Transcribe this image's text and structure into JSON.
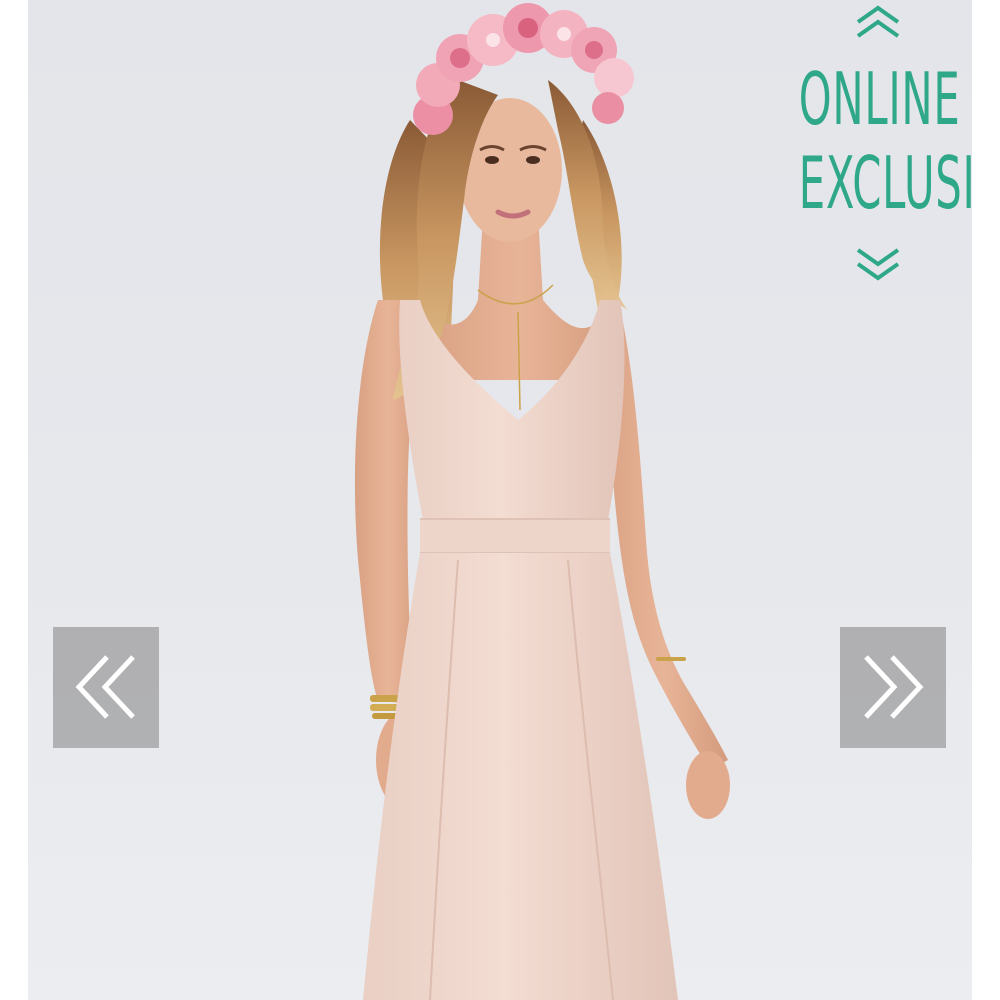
{
  "carousel": {
    "badge": {
      "line1": "ONLINE",
      "line2": "EXCLUSIVE",
      "color": "#2fa889",
      "icon_top": "double-chevron-up-icon",
      "icon_bottom": "double-chevron-down-icon"
    },
    "prev_button": {
      "icon": "double-chevron-left-icon"
    },
    "next_button": {
      "icon": "double-chevron-right-icon"
    },
    "photo": {
      "subject": "model in blush pink maxi dress with floral crown"
    }
  }
}
